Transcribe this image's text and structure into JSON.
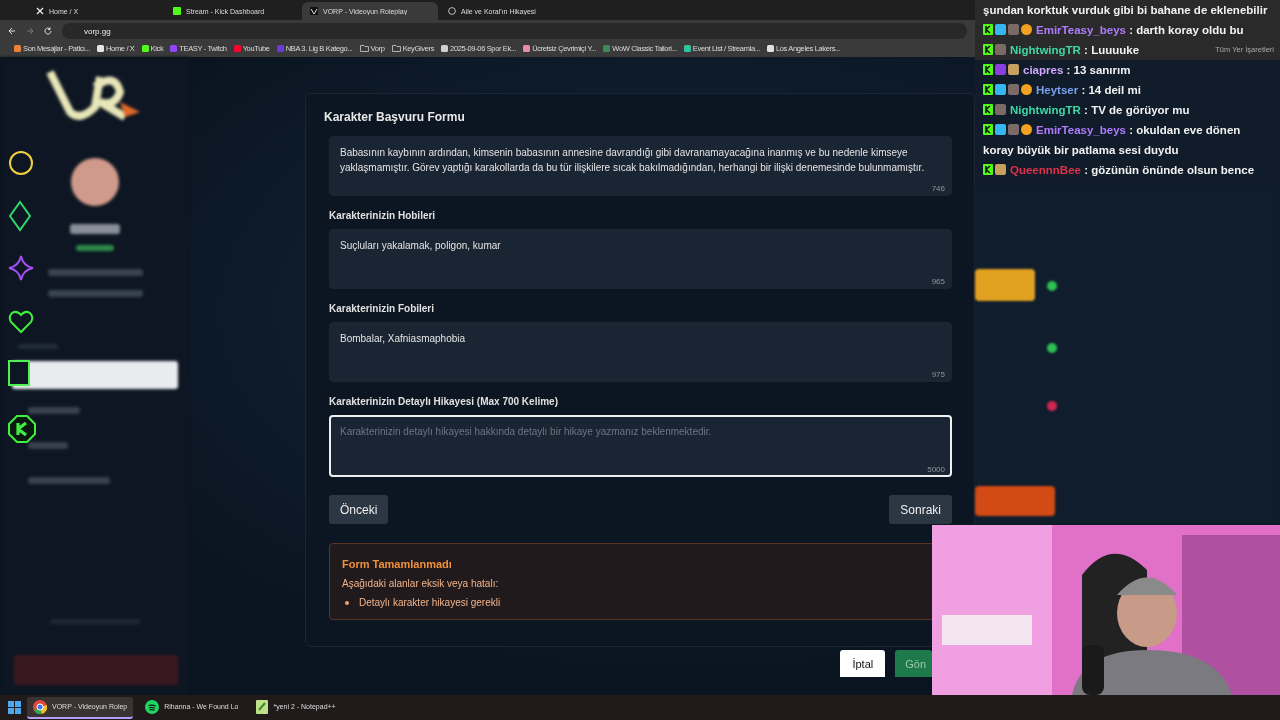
{
  "browser": {
    "tabs": [
      {
        "title": "Home / X",
        "kind": "x",
        "selected": false
      },
      {
        "title": "Stream - Kick Dashboard",
        "kind": "kick",
        "selected": false
      },
      {
        "title": "VORP - Videoyun Roleplay",
        "kind": "vorp",
        "selected": true
      },
      {
        "title": "Aile ve Koral'ın Hikayesi",
        "kind": "globe",
        "selected": false
      }
    ],
    "address": "vorp.gg",
    "bookmarks": [
      {
        "label": "Son Mesajlar - Patlcı...",
        "kind": "site",
        "color": "#e8823a"
      },
      {
        "label": "Home / X",
        "kind": "site",
        "color": "#e6e6e6"
      },
      {
        "label": "Kick",
        "kind": "site",
        "color": "#53fc18"
      },
      {
        "label": "TEASY - Twitch",
        "kind": "site",
        "color": "#9147ff"
      },
      {
        "label": "YouTube",
        "kind": "site",
        "color": "#ff0033"
      },
      {
        "label": "NBA 3. Lig B Katego...",
        "kind": "site",
        "color": "#6a3cd6"
      },
      {
        "label": "Vorp",
        "kind": "folder"
      },
      {
        "label": "KeyGivers",
        "kind": "folder"
      },
      {
        "label": "2025-09-06 Spor Ek...",
        "kind": "site",
        "color": "#d0d0d0"
      },
      {
        "label": "Ücretsiz Çevrimiçi Y...",
        "kind": "site",
        "color": "#e88ab0"
      },
      {
        "label": "WoW Classic Tailori...",
        "kind": "site",
        "color": "#3a8a5a"
      },
      {
        "label": "Event List / Streamla...",
        "kind": "site",
        "color": "#2ec4a0"
      },
      {
        "label": "Los Angeles Lakers...",
        "kind": "site",
        "color": "#e0e0e0"
      }
    ],
    "bookmarks_end": "Tüm Yer İşaretleri"
  },
  "form": {
    "title": "Karakter Başvuru Formu",
    "fields": [
      {
        "value": "Babasının kaybının ardından, kimsenin babasının annesine davrandığı gibi davranamayacağına inanmış ve bu nedenle kimseye yaklaşmamıştır. Görev yaptığı karakollarda da bu tür ilişkilere sıcak bakılmadığından, herhangi bir ilişki denemesinde bulunmamıştır.",
        "counter": "746",
        "focused": false
      },
      {
        "label": "Karakterinizin Hobileri",
        "value": "Suçluları yakalamak, poligon, kumar",
        "counter": "965",
        "focused": false
      },
      {
        "label": "Karakterinizin Fobileri",
        "value": "Bombalar, Xafniasmaphobia",
        "counter": "975",
        "focused": false
      },
      {
        "label": "Karakterinizin Detaylı Hikayesi (Max 700 Kelime)",
        "placeholder": "Karakterinizin detaylı hikayesi hakkında detaylı bir hikaye yazmanız beklenmektedir.",
        "counter": "5000",
        "focused": true
      }
    ],
    "prev": "Önceki",
    "next": "Sonraki",
    "error": {
      "title": "Form Tamamlanmadı",
      "message": "Aşağıdaki alanlar eksik veya hatalı:",
      "items": [
        "Detaylı karakter hikayesi gerekli"
      ]
    },
    "cancel": "İptal",
    "submit": "Gön"
  },
  "chat": [
    {
      "text": "şundan korktuk vurduk gibi bi bahane de eklenebilir"
    },
    {
      "user": "EmirTeasy_beys",
      "color": "#b07cff",
      "text": " : darth koray oldu bu",
      "badges": [
        {
          "kind": "kick"
        },
        {
          "kind": "gem"
        },
        {
          "kind": "bot"
        },
        {
          "kind": "coin"
        }
      ]
    },
    {
      "user": "NightwingTR",
      "color": "#3fd8a4",
      "text": " : Luuuuke",
      "badges": [
        {
          "kind": "kick"
        },
        {
          "kind": "bot"
        }
      ]
    },
    {
      "user": "ciapres",
      "color": "#d2a8ff",
      "text": " : 13 sanırım",
      "badges": [
        {
          "kind": "kick"
        },
        {
          "kind": "crystal"
        },
        {
          "kind": "cat"
        }
      ]
    },
    {
      "user": "Heytser",
      "color": "#7aa0f0",
      "text": " : 14 deil mi",
      "badges": [
        {
          "kind": "kick"
        },
        {
          "kind": "gem"
        },
        {
          "kind": "bot"
        },
        {
          "kind": "coin"
        }
      ]
    },
    {
      "user": "NightwingTR",
      "color": "#3fd8a4",
      "text": " : TV de görüyor mu",
      "badges": [
        {
          "kind": "kick"
        },
        {
          "kind": "bot"
        }
      ]
    },
    {
      "user": "EmirTeasy_beys",
      "color": "#b07cff",
      "text": " : okuldan eve dönen koray büyük bir patlama sesi duydu",
      "badges": [
        {
          "kind": "kick"
        },
        {
          "kind": "gem"
        },
        {
          "kind": "bot"
        },
        {
          "kind": "coin"
        }
      ]
    },
    {
      "user": "QueennnBee",
      "color": "#e0304a",
      "text": " : gözünün önünde olsun bence",
      "badges": [
        {
          "kind": "kick"
        },
        {
          "kind": "cat"
        }
      ]
    }
  ],
  "taskbar": [
    {
      "label": "VORP - Videoyun Rolep",
      "kind": "chrome",
      "selected": true
    },
    {
      "label": "Rihanna - We Found Lo",
      "kind": "spotify",
      "selected": false
    },
    {
      "label": "*yeni 2 - Notepad++",
      "kind": "notepad",
      "selected": false
    }
  ]
}
